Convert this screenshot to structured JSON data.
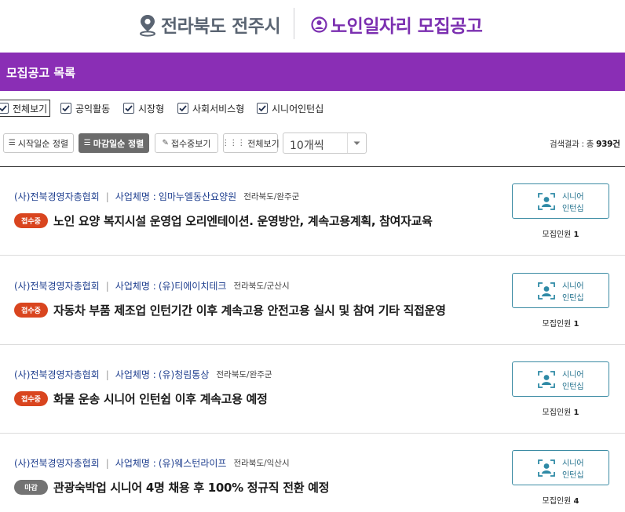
{
  "header": {
    "location": "전라북도 전주시",
    "page_title": "노인일자리 모집공고",
    "accent_color": "#8a2eb5"
  },
  "section": {
    "title": "모집공고 목록"
  },
  "filters": [
    {
      "label": "전체보기",
      "checked": true
    },
    {
      "label": "공익활동",
      "checked": true
    },
    {
      "label": "시장형",
      "checked": true
    },
    {
      "label": "사회서비스형",
      "checked": true
    },
    {
      "label": "시니어인턴십",
      "checked": true
    }
  ],
  "toolbar": {
    "sort_start": "시작일순 정렬",
    "sort_deadline": "마감일순 정렬",
    "view_receiving": "접수중보기",
    "view_all": "전체보기",
    "page_size": "10개씩",
    "result_prefix": "검색결과 : 총",
    "result_count": "939",
    "result_suffix": "건"
  },
  "listings": [
    {
      "org": "(사)전북경영자총협회",
      "biz_label": "사업체명 :",
      "biz_name": "임마누엘동산요양원",
      "region": "전라북도/완주군",
      "status": "접수중",
      "title": "노인 요양 복지시설 운영업 오리엔테이션. 운영방안, 계속고용계획, 참여자교육",
      "type_line1": "시니어",
      "type_line2": "인턴십",
      "recruit_label": "모집인원",
      "recruit_count": "1"
    },
    {
      "org": "(사)전북경영자총협회",
      "biz_label": "사업체명 :",
      "biz_name": "(유)티에이치테크",
      "region": "전라북도/군산시",
      "status": "접수중",
      "title": "자동차 부품 제조업 인턴기간 이후 계속고용 안전고용 실시 및 참여 기타 직접운영",
      "type_line1": "시니어",
      "type_line2": "인턴십",
      "recruit_label": "모집인원",
      "recruit_count": "1"
    },
    {
      "org": "(사)전북경영자총협회",
      "biz_label": "사업체명 :",
      "biz_name": "(유)청림통상",
      "region": "전라북도/완주군",
      "status": "접수중",
      "title": "화물 운송 시니어 인턴쉽 이후 계속고용 예정",
      "type_line1": "시니어",
      "type_line2": "인턴십",
      "recruit_label": "모집인원",
      "recruit_count": "1"
    },
    {
      "org": "(사)전북경영자총협회",
      "biz_label": "사업체명 :",
      "biz_name": "(유)웨스턴라이프",
      "region": "전라북도/익산시",
      "status": "마감",
      "title": "관광숙박업 시니어 4명 채용 후 100% 정규직 전환 예정",
      "type_line1": "시니어",
      "type_line2": "인턴십",
      "recruit_label": "모집인원",
      "recruit_count": "4"
    }
  ]
}
